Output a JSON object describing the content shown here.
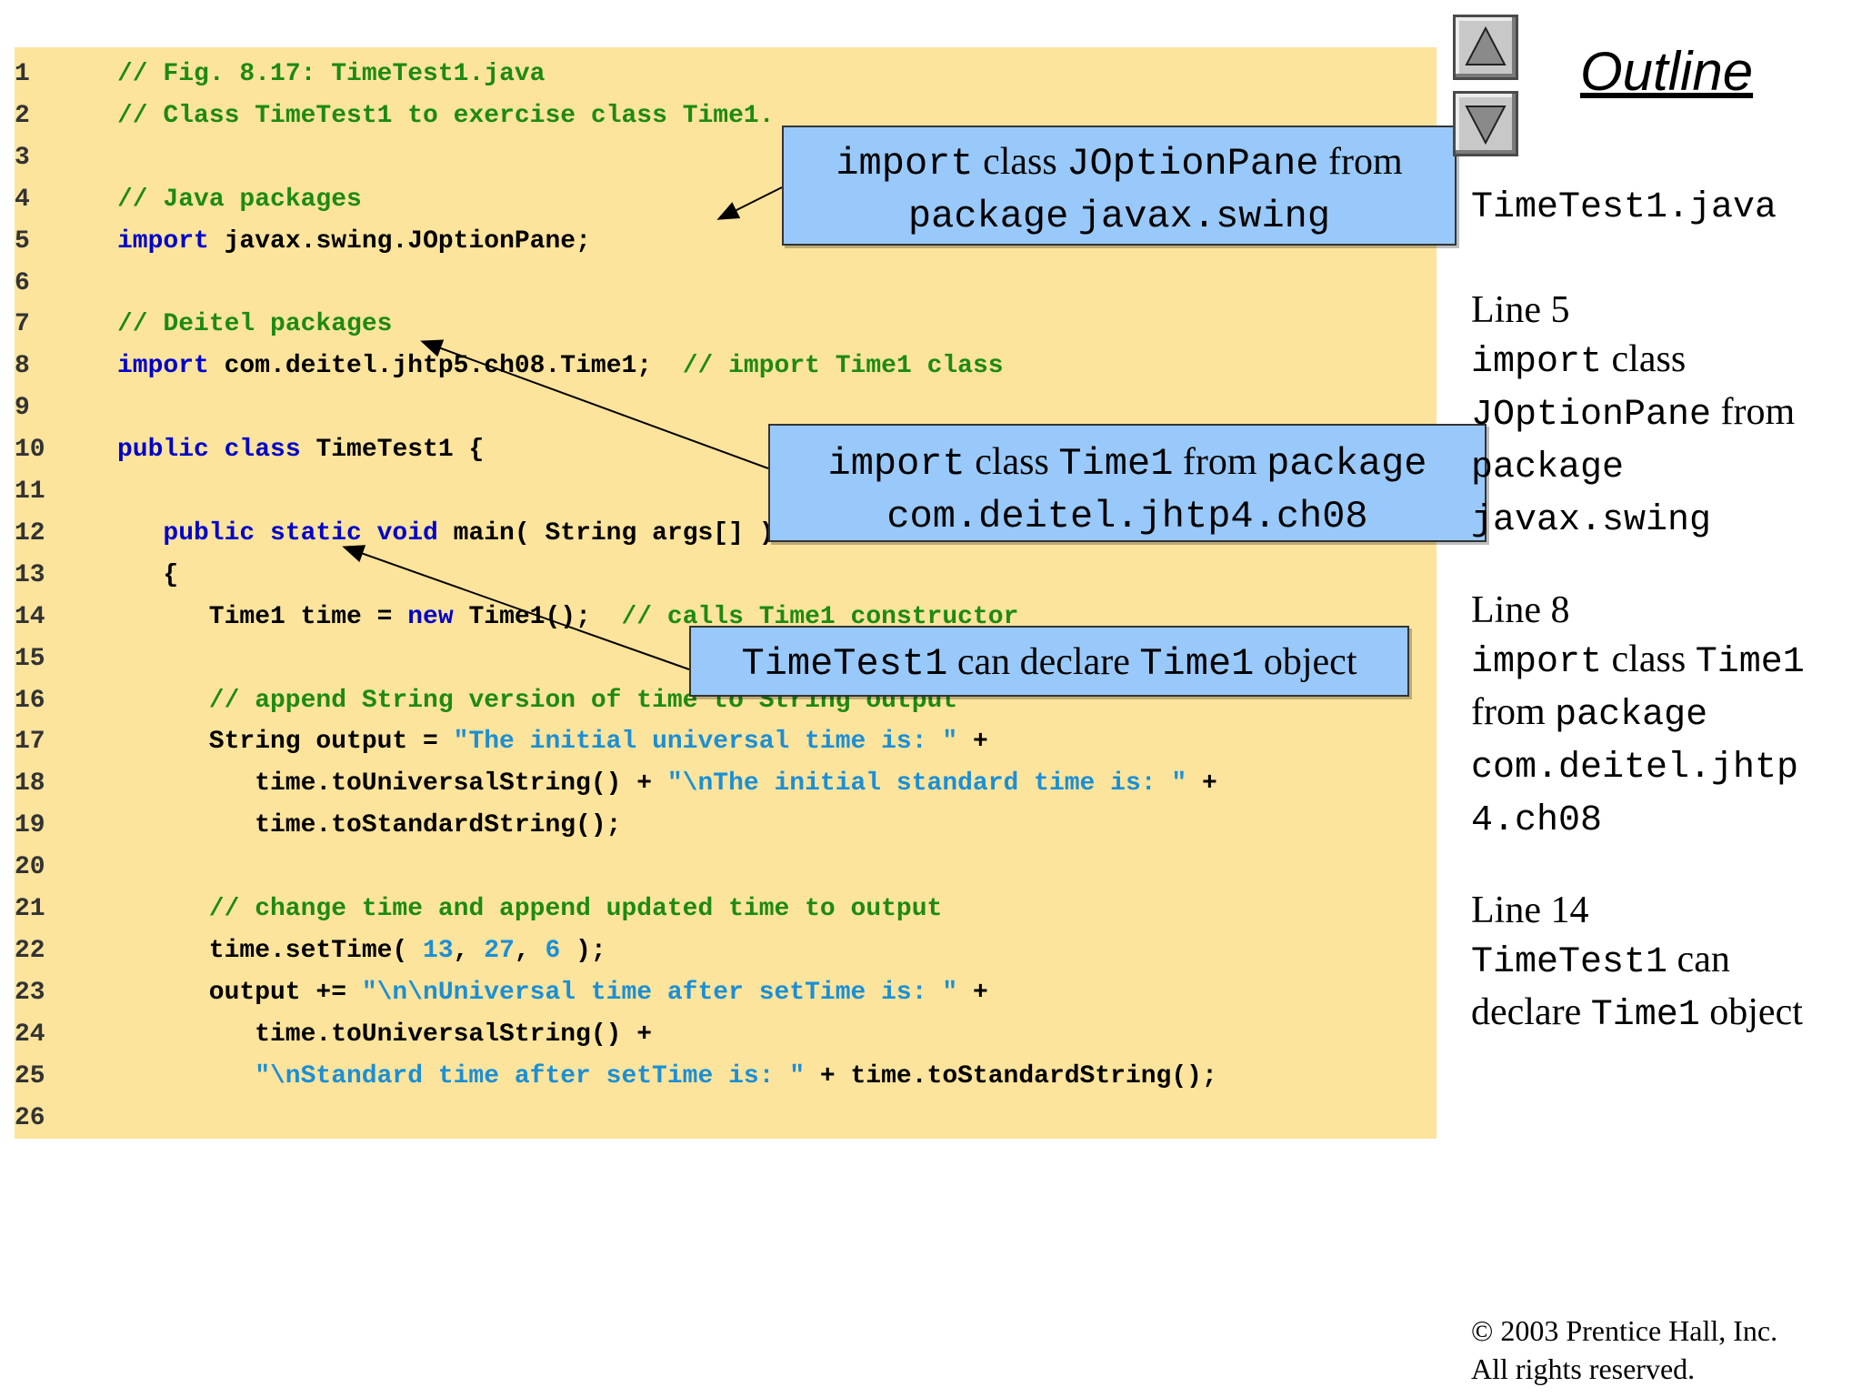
{
  "code_lines": [
    {
      "n": "1",
      "indent": 0,
      "parts": [
        {
          "t": "// Fig. 8.17: TimeTest1.java",
          "c": "cm"
        }
      ]
    },
    {
      "n": "2",
      "indent": 0,
      "parts": [
        {
          "t": "// Class TimeTest1 to exercise class Time1.",
          "c": "cm"
        }
      ]
    },
    {
      "n": "3",
      "indent": 0,
      "parts": []
    },
    {
      "n": "4",
      "indent": 0,
      "parts": [
        {
          "t": "// Java packages",
          "c": "cm"
        }
      ]
    },
    {
      "n": "5",
      "indent": 0,
      "parts": [
        {
          "t": "import",
          "c": "kw"
        },
        {
          "t": " javax.swing.JOptionPane;",
          "c": "pl"
        }
      ]
    },
    {
      "n": "6",
      "indent": 0,
      "parts": []
    },
    {
      "n": "7",
      "indent": 0,
      "parts": [
        {
          "t": "// Deitel packages",
          "c": "cm"
        }
      ]
    },
    {
      "n": "8",
      "indent": 0,
      "parts": [
        {
          "t": "import",
          "c": "kw"
        },
        {
          "t": " com.deitel.jhtp5.ch08.Time1;  ",
          "c": "pl"
        },
        {
          "t": "// import Time1 class",
          "c": "cm"
        }
      ]
    },
    {
      "n": "9",
      "indent": 0,
      "parts": []
    },
    {
      "n": "10",
      "indent": 0,
      "parts": [
        {
          "t": "public class",
          "c": "kw"
        },
        {
          "t": " TimeTest1 {",
          "c": "pl"
        }
      ]
    },
    {
      "n": "11",
      "indent": 0,
      "parts": []
    },
    {
      "n": "12",
      "indent": 3,
      "parts": [
        {
          "t": "public static void",
          "c": "kw"
        },
        {
          "t": " main( String args[] )",
          "c": "pl"
        }
      ]
    },
    {
      "n": "13",
      "indent": 3,
      "parts": [
        {
          "t": "{",
          "c": "pl"
        }
      ]
    },
    {
      "n": "14",
      "indent": 6,
      "parts": [
        {
          "t": "Time1 time = ",
          "c": "pl"
        },
        {
          "t": "new",
          "c": "kw"
        },
        {
          "t": " Time1();  ",
          "c": "pl"
        },
        {
          "t": "// calls Time1 constructor",
          "c": "cm"
        }
      ]
    },
    {
      "n": "15",
      "indent": 0,
      "parts": []
    },
    {
      "n": "16",
      "indent": 6,
      "parts": [
        {
          "t": "// append String version of time to String output",
          "c": "cm"
        }
      ]
    },
    {
      "n": "17",
      "indent": 6,
      "parts": [
        {
          "t": "String output = ",
          "c": "pl"
        },
        {
          "t": "\"The initial universal time is: \"",
          "c": "st"
        },
        {
          "t": " +",
          "c": "pl"
        }
      ]
    },
    {
      "n": "18",
      "indent": 9,
      "parts": [
        {
          "t": "time.toUniversalString() + ",
          "c": "pl"
        },
        {
          "t": "\"\\nThe initial standard time is: \"",
          "c": "st"
        },
        {
          "t": " +",
          "c": "pl"
        }
      ]
    },
    {
      "n": "19",
      "indent": 9,
      "parts": [
        {
          "t": "time.toStandardString();",
          "c": "pl"
        }
      ]
    },
    {
      "n": "20",
      "indent": 0,
      "parts": []
    },
    {
      "n": "21",
      "indent": 6,
      "parts": [
        {
          "t": "// change time and append updated time to output",
          "c": "cm"
        }
      ]
    },
    {
      "n": "22",
      "indent": 6,
      "parts": [
        {
          "t": "time.setTime( ",
          "c": "pl"
        },
        {
          "t": "13",
          "c": "st"
        },
        {
          "t": ", ",
          "c": "pl"
        },
        {
          "t": "27",
          "c": "st"
        },
        {
          "t": ", ",
          "c": "pl"
        },
        {
          "t": "6",
          "c": "st"
        },
        {
          "t": " );",
          "c": "pl"
        }
      ]
    },
    {
      "n": "23",
      "indent": 6,
      "parts": [
        {
          "t": "output += ",
          "c": "pl"
        },
        {
          "t": "\"\\n\\nUniversal time after setTime is: \"",
          "c": "st"
        },
        {
          "t": " +",
          "c": "pl"
        }
      ]
    },
    {
      "n": "24",
      "indent": 9,
      "parts": [
        {
          "t": "time.toUniversalString() +",
          "c": "pl"
        }
      ]
    },
    {
      "n": "25",
      "indent": 9,
      "parts": [
        {
          "t": "\"\\nStandard time after setTime is: \"",
          "c": "st"
        },
        {
          "t": " + time.toStandardString();",
          "c": "pl"
        }
      ]
    },
    {
      "n": "26",
      "indent": 0,
      "parts": []
    }
  ],
  "callouts": {
    "c1": {
      "a": "import",
      "b": " class ",
      "c": "JOptionPane",
      "d": " from",
      "e": "package",
      "f": " ",
      "g": "javax.swing"
    },
    "c2": {
      "a": "import",
      "b": " class ",
      "c": "Time1",
      "d": " from ",
      "e": "package",
      "f": "com.deitel.jhtp4.ch08"
    },
    "c3": {
      "a": "TimeTest1",
      "b": " can declare ",
      "c": "Time1",
      "d": " object"
    }
  },
  "sidebar": {
    "title": "Outline",
    "file": "TimeTest1.java",
    "b1": {
      "h": "Line 5",
      "l1a": "import",
      "l1b": " class",
      "l2a": "JOptionPane",
      "l2b": " from",
      "l3": "package",
      "l4": "javax.swing"
    },
    "b2": {
      "h": "Line 8",
      "l1a": "import",
      "l1b": " class ",
      "l1c": "Time1",
      "l2a": "from ",
      "l2b": "package",
      "l3": "com.deitel.jhtp",
      "l4": "4.ch08"
    },
    "b3": {
      "h": "Line 14",
      "l1a": "TimeTest1",
      "l1b": " can",
      "l2a": "declare ",
      "l2b": "Time1",
      "l2c": " object"
    }
  },
  "copyright": {
    "line1": "© 2003 Prentice Hall, Inc.",
    "line2": "All rights reserved."
  },
  "colors": {
    "panel": "#fde49c",
    "callout": "#99c9fa",
    "comment": "#1e8a12",
    "keyword": "#0000cc",
    "string": "#1a8fd6"
  },
  "icons": {
    "up": "triangle-up-icon",
    "down": "triangle-down-icon"
  }
}
